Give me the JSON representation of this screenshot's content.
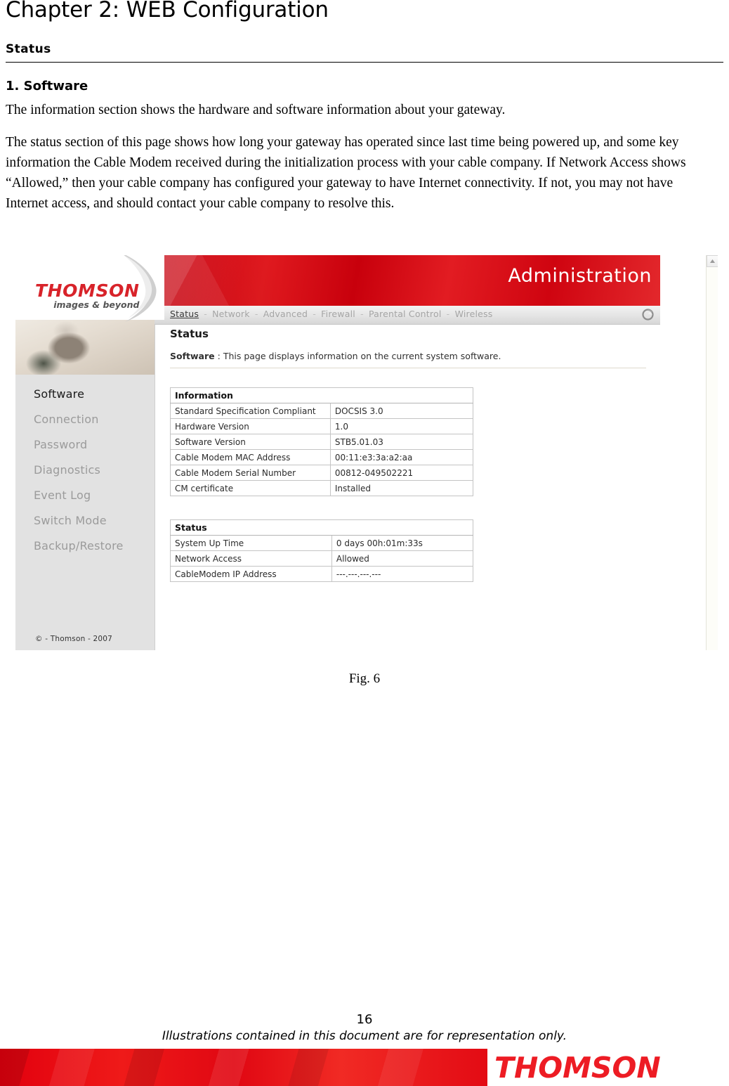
{
  "document": {
    "chapter_title": "Chapter 2: WEB Configuration",
    "section_heading": "Status",
    "subsection_heading": "1. Software",
    "paragraph_1": "The information section shows the hardware and software information about your gateway.",
    "paragraph_2": "The status section of this page shows how long your gateway has operated since last time being powered up, and some key information the Cable Modem received during the initialization process with your cable company. If Network Access shows “Allowed,” then your cable company has configured your gateway to have Internet connectivity. If not, you may not have Internet access, and should contact your cable company to resolve this.",
    "figure_caption": "Fig. 6",
    "page_number": "16",
    "footer_note": "Illustrations contained in this document are for representation only.",
    "footer_brand": "THOMSON"
  },
  "screenshot": {
    "logo": {
      "brand": "THOMSON",
      "tagline": "images & beyond",
      "swoosh_icon": "swoosh-icon"
    },
    "banner": {
      "title": "Administration",
      "accent_color": "#d9000f"
    },
    "nav": {
      "separator": "-",
      "items": [
        {
          "label": "Status",
          "active": true
        },
        {
          "label": "Network",
          "active": false
        },
        {
          "label": "Advanced",
          "active": false
        },
        {
          "label": "Firewall",
          "active": false
        },
        {
          "label": "Parental Control",
          "active": false
        },
        {
          "label": "Wireless",
          "active": false
        }
      ],
      "refresh_icon": "refresh-icon"
    },
    "sidebar": {
      "hero_image": "person-with-laptop-photo",
      "items": [
        {
          "label": "Software",
          "active": true
        },
        {
          "label": "Connection",
          "active": false
        },
        {
          "label": "Password",
          "active": false
        },
        {
          "label": "Diagnostics",
          "active": false
        },
        {
          "label": "Event Log",
          "active": false
        },
        {
          "label": "Switch Mode",
          "active": false
        },
        {
          "label": "Backup/Restore",
          "active": false
        }
      ],
      "copyright": "© - Thomson - 2007"
    },
    "content": {
      "title": "Status",
      "subtitle_label": "Software",
      "subtitle_separator": ":",
      "subtitle_text": "This page displays information on the current system software.",
      "information_table": {
        "caption": "Information",
        "rows": [
          {
            "key": "Standard Specification Compliant",
            "value": "DOCSIS 3.0"
          },
          {
            "key": "Hardware Version",
            "value": "1.0"
          },
          {
            "key": "Software Version",
            "value": "STB5.01.03"
          },
          {
            "key": "Cable Modem MAC Address",
            "value": "00:11:e3:3a:a2:aa"
          },
          {
            "key": "Cable Modem Serial Number",
            "value": "00812-049502221"
          },
          {
            "key": "CM certificate",
            "value": "Installed"
          }
        ]
      },
      "status_table": {
        "caption": "Status",
        "rows": [
          {
            "key": "System Up Time",
            "value": "0 days 00h:01m:33s"
          },
          {
            "key": "Network Access",
            "value": "Allowed"
          },
          {
            "key": "CableModem IP Address",
            "value": "---.---.---.---"
          }
        ]
      }
    },
    "scrollbar": {
      "up_arrow_icon": "chevron-up-icon"
    }
  }
}
